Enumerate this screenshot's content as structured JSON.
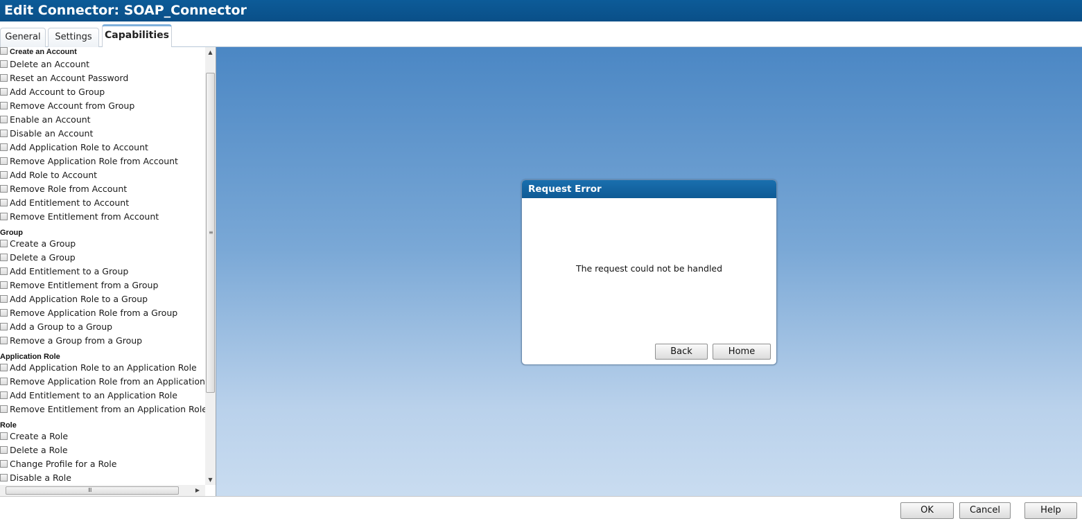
{
  "window": {
    "title": "Edit Connector: SOAP_Connector"
  },
  "tabs": [
    {
      "label": "General"
    },
    {
      "label": "Settings"
    },
    {
      "label": "Capabilities",
      "active": true
    }
  ],
  "capabilities": {
    "account": {
      "items": [
        "Create an Account",
        "Delete an Account",
        "Reset an Account Password",
        "Add Account to Group",
        "Remove Account from Group",
        "Enable an Account",
        "Disable an Account",
        "Add Application Role to Account",
        "Remove Application Role from Account",
        "Add Role to Account",
        "Remove Role from Account",
        "Add Entitlement to Account",
        "Remove Entitlement from Account"
      ]
    },
    "group": {
      "header": "Group",
      "items": [
        "Create a Group",
        "Delete a Group",
        "Add Entitlement to a Group",
        "Remove Entitlement from a Group",
        "Add Application Role to a Group",
        "Remove Application Role from a Group",
        "Add a Group to a Group",
        "Remove a Group from a Group"
      ]
    },
    "application_role": {
      "header": "Application Role",
      "items": [
        "Add Application Role to an Application Role",
        "Remove Application Role from an Application Role",
        "Add Entitlement to an Application Role",
        "Remove Entitlement from an Application Role"
      ]
    },
    "role": {
      "header": "Role",
      "items": [
        "Create a Role",
        "Delete a Role",
        "Change Profile for a Role",
        "Disable a Role"
      ]
    }
  },
  "dialog": {
    "title": "Request Error",
    "message": "The request could not be handled",
    "back_label": "Back",
    "home_label": "Home"
  },
  "footer": {
    "ok_label": "OK",
    "cancel_label": "Cancel",
    "help_label": "Help"
  },
  "icons": {
    "scroll_up": "▲",
    "scroll_down": "▼",
    "scroll_right": "▶",
    "grip_v": "≡",
    "grip_h": "Ⅲ"
  },
  "colors": {
    "titlebar": "#0c5b98",
    "dialog_header": "#1a6fae",
    "content_top": "#4b87c4",
    "content_bottom": "#c9dcf0"
  }
}
